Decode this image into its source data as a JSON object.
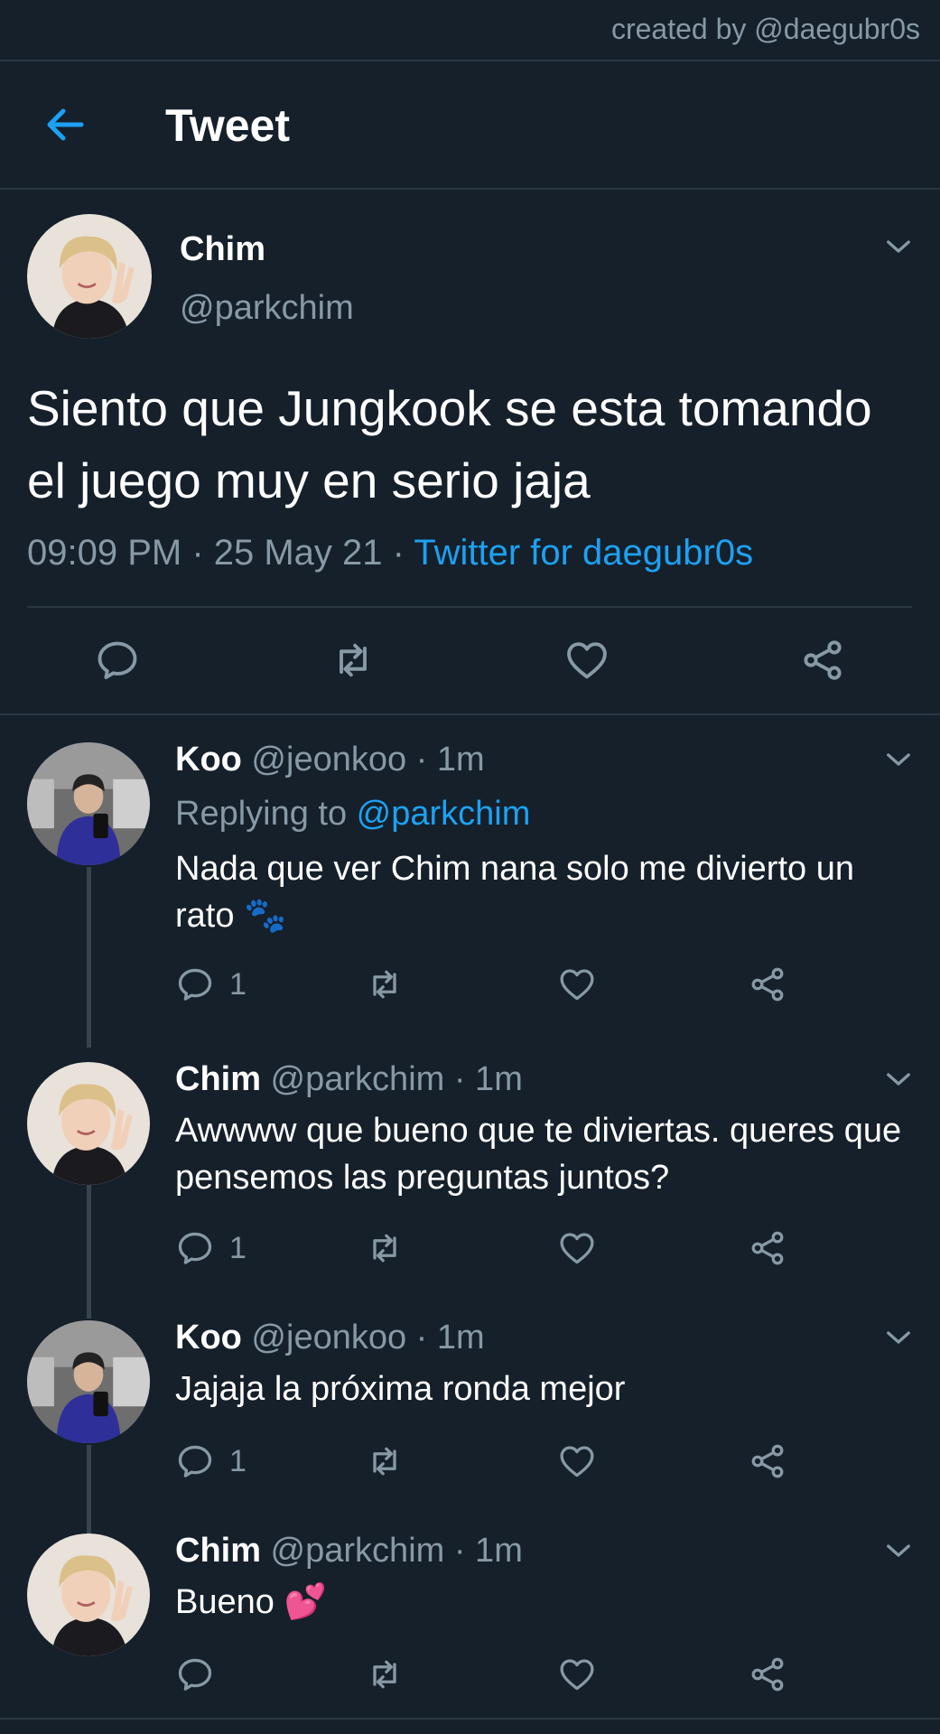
{
  "credit": "created by @daegubr0s",
  "header": {
    "title": "Tweet",
    "back_icon": "arrow-left-icon"
  },
  "colors": {
    "background": "#15202b",
    "accent": "#1da1f2",
    "secondary_text": "#8899a6",
    "divider": "#2a3742"
  },
  "main_tweet": {
    "name": "Chim",
    "handle": "@parkchim",
    "text": "Siento que Jungkook se esta tomando el juego muy en serio jaja",
    "time": "09:09 PM · 25 May 21 · ",
    "source": "Twitter for daegubr0s",
    "actions": [
      "reply-icon",
      "retweet-icon",
      "like-icon",
      "share-icon"
    ]
  },
  "replies": [
    {
      "name": "Koo",
      "meta": " @jeonkoo · 1m",
      "replying_label": "Replying to ",
      "replying_to": "@parkchim",
      "text": "Nada que ver Chim nana solo me divierto un rato 🐾",
      "reply_count": "1"
    },
    {
      "name": "Chim",
      "meta": " @parkchim · 1m",
      "text": "Awwww que bueno que te diviertas. queres que pensemos las preguntas juntos?",
      "reply_count": "1"
    },
    {
      "name": "Koo",
      "meta": " @jeonkoo · 1m",
      "text": "Jajaja la próxima ronda mejor",
      "reply_count": "1"
    },
    {
      "name": "Chim",
      "meta": " @parkchim · 1m",
      "text": "Bueno 💕",
      "reply_count": ""
    }
  ]
}
